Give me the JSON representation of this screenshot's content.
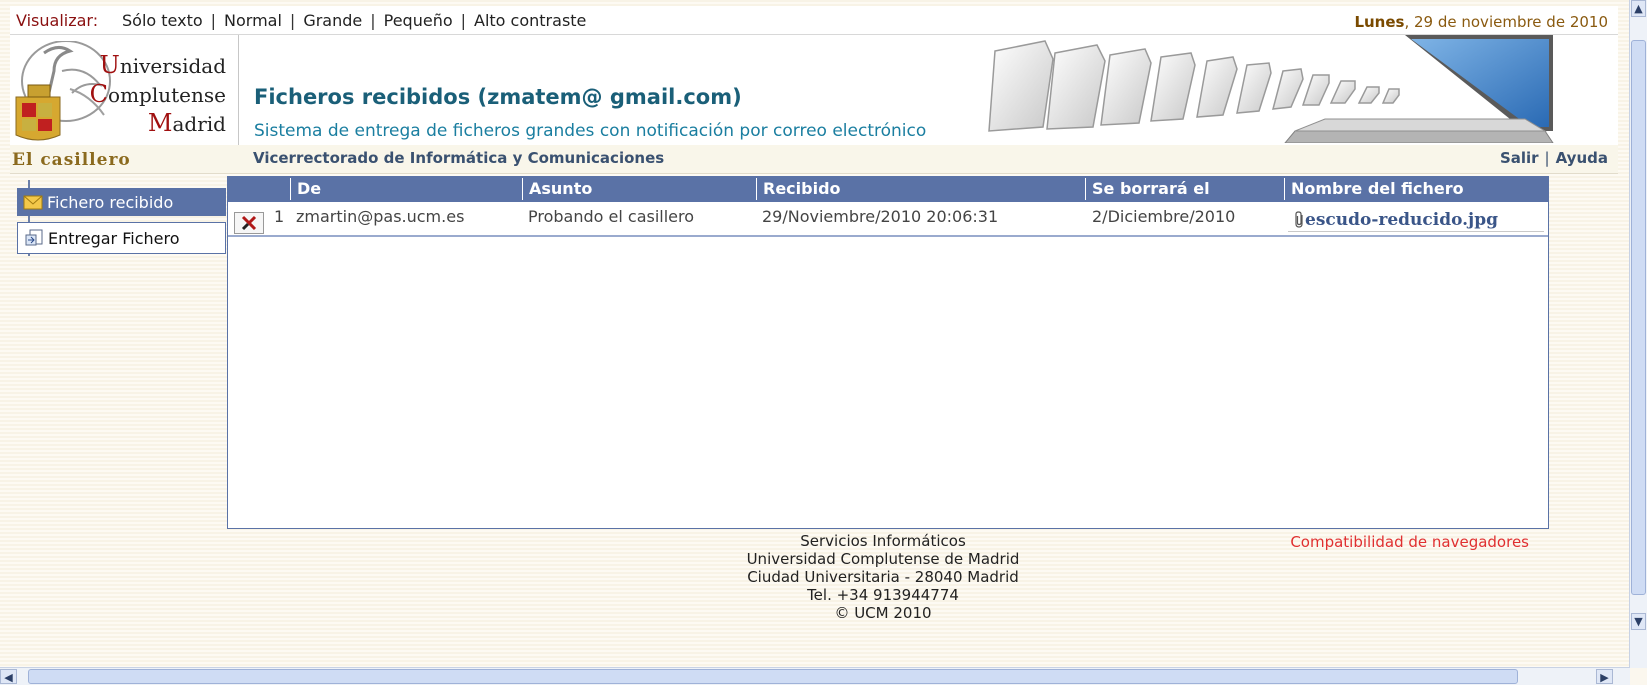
{
  "topbar": {
    "visualizar_label": "Visualizar:",
    "options": [
      "Sólo texto",
      "Normal",
      "Grande",
      "Pequeño",
      "Alto contraste"
    ],
    "date_day": "Lunes",
    "date_rest": ", 29 de noviembre de 2010"
  },
  "logo": {
    "line1_cap": "U",
    "line1_rest": "niversidad",
    "line2_cap": "C",
    "line2_rest": "omplutense",
    "line3_cap": "M",
    "line3_rest": "adrid"
  },
  "header": {
    "title": "Ficheros recibidos (zmatem@ gmail.com)",
    "subtitle": "Sistema de entrega de ficheros grandes con notificación por correo electrónico"
  },
  "subbar": {
    "app_name": "El casillero",
    "department": "Vicerrectorado de Informática y Comunicaciones",
    "logout": "Salir",
    "help": "Ayuda"
  },
  "nav": {
    "items": [
      {
        "label": "Fichero recibido",
        "icon": "mail-icon"
      },
      {
        "label": "Entregar Fichero",
        "icon": "send-file-icon"
      }
    ]
  },
  "table": {
    "columns": [
      "De",
      "Asunto",
      "Recibido",
      "Se borrará el",
      "Nombre del fichero"
    ],
    "rows": [
      {
        "index": "1",
        "from": "zmartin@pas.ucm.es",
        "subject": "Probando el casillero",
        "received": "29/Noviembre/2010 20:06:31",
        "delete_on": "2/Diciembre/2010",
        "file_name": "escudo-reducido.jpg"
      }
    ]
  },
  "footer": {
    "lines": [
      "Servicios Informáticos",
      "Universidad Complutense de Madrid",
      "Ciudad Universitaria - 28040 Madrid",
      "Tel. +34 913944774",
      "© UCM 2010"
    ],
    "compat_link": "Compatibilidad de navegadores"
  },
  "colors": {
    "nav_blue": "#5a72a6",
    "title_teal": "#1a5f78",
    "link_red": "#e03030"
  }
}
